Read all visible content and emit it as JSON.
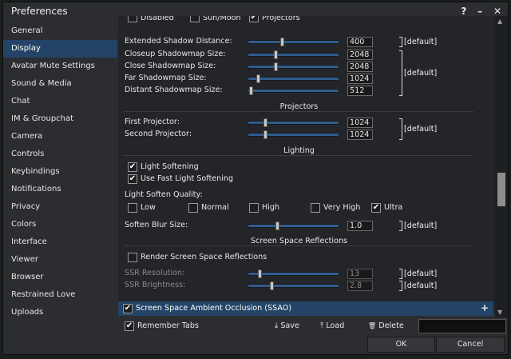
{
  "window": {
    "title": "Preferences",
    "help_icon": "?",
    "minimize_icon": "–",
    "close_icon": "✕"
  },
  "sidebar": {
    "items": [
      {
        "label": "General"
      },
      {
        "label": "Display",
        "active": true
      },
      {
        "label": "Avatar Mute Settings"
      },
      {
        "label": "Sound & Media"
      },
      {
        "label": "Chat"
      },
      {
        "label": "IM & Groupchat"
      },
      {
        "label": "Camera"
      },
      {
        "label": "Controls"
      },
      {
        "label": "Keybindings"
      },
      {
        "label": "Notifications"
      },
      {
        "label": "Privacy"
      },
      {
        "label": "Colors"
      },
      {
        "label": "Interface"
      },
      {
        "label": "Viewer"
      },
      {
        "label": "Browser"
      },
      {
        "label": "Restrained Love"
      },
      {
        "label": "Uploads"
      }
    ]
  },
  "panel": {
    "top_checks": {
      "disabled": {
        "label": "Disabled",
        "checked": false
      },
      "sun_moon": {
        "label": "Sun/Moon",
        "checked": false
      },
      "projectors": {
        "label": "Projectors",
        "checked": true
      }
    },
    "shadows": {
      "extended": {
        "label": "Extended Shadow Distance:",
        "value": "400",
        "fraction": 0.37
      },
      "closeup": {
        "label": "Closeup Shadowmap Size:",
        "value": "2048",
        "fraction": 0.3
      },
      "close": {
        "label": "Close Shadowmap Size:",
        "value": "2048",
        "fraction": 0.3
      },
      "far": {
        "label": "Far Shadowmap Size:",
        "value": "1024",
        "fraction": 0.1
      },
      "distant": {
        "label": "Distant Shadowmap Size:",
        "value": "512",
        "fraction": 0.02
      }
    },
    "default_label": "[default]",
    "projectors": {
      "header": "Projectors",
      "first": {
        "label": "First Projector:",
        "value": "1024",
        "fraction": 0.18
      },
      "second": {
        "label": "Second Projector:",
        "value": "1024",
        "fraction": 0.18
      }
    },
    "lighting": {
      "header": "Lighting",
      "light_softening": {
        "label": "Light Softening",
        "checked": true
      },
      "fast_softening": {
        "label": "Use Fast Light Softening",
        "checked": true
      },
      "quality_label": "Light Soften Quality:",
      "quality_options": [
        {
          "label": "Low",
          "checked": false
        },
        {
          "label": "Normal",
          "checked": false
        },
        {
          "label": "High",
          "checked": false
        },
        {
          "label": "Very High",
          "checked": false
        },
        {
          "label": "Ultra",
          "checked": true
        }
      ],
      "blur": {
        "label": "Soften Blur Size:",
        "value": "1.0",
        "fraction": 0.32
      }
    },
    "ssr": {
      "header": "Screen Space Reflections",
      "render": {
        "label": "Render Screen Space Reflections",
        "checked": false
      },
      "resolution": {
        "label": "SSR Resolution:",
        "value": "13",
        "fraction": 0.12
      },
      "brightness": {
        "label": "SSR Brightness:",
        "value": "2.8",
        "fraction": 0.25
      }
    },
    "ssao": {
      "label": "Screen Space Ambient Occlusion (SSAO)",
      "checked": true,
      "expand_icon": "+"
    }
  },
  "bottom": {
    "remember_tabs": {
      "label": "Remember Tabs",
      "checked": true
    },
    "save": "Save",
    "load": "Load",
    "delete": "Delete",
    "save_icon": "⤓",
    "load_icon": "⤒",
    "delete_icon": "🗑",
    "ok": "OK",
    "cancel": "Cancel"
  },
  "checkmark": "✔"
}
